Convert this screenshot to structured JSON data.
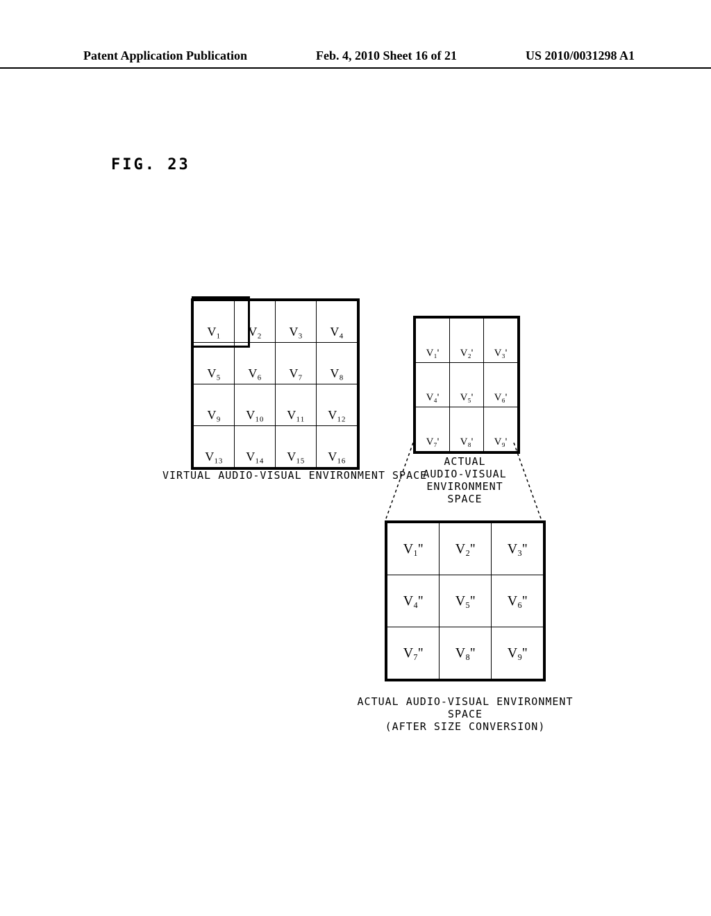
{
  "header": {
    "left": "Patent Application Publication",
    "center": "Feb. 4, 2010  Sheet 16 of 21",
    "right": "US 2010/0031298 A1"
  },
  "figure_label": "FIG. 23",
  "captions": {
    "virtual": "VIRTUAL AUDIO-VISUAL ENVIRONMENT SPACE",
    "actual_line1": "ACTUAL",
    "actual_line2": "AUDIO-VISUAL",
    "actual_line3": "ENVIRONMENT SPACE",
    "after_line1": "ACTUAL AUDIO-VISUAL ENVIRONMENT SPACE",
    "after_line2": "(AFTER SIZE CONVERSION)"
  },
  "grid4": {
    "r0": {
      "c0": "V₁",
      "c1": "V₂",
      "c2": "V₃",
      "c3": "V₄"
    },
    "r1": {
      "c0": "V₅",
      "c1": "V₆",
      "c2": "V₇",
      "c3": "V₈"
    },
    "r2": {
      "c0": "V₉",
      "c1": "V₁₀",
      "c2": "V₁₁",
      "c3": "V₁₂"
    },
    "r3": {
      "c0": "V₁₃",
      "c1": "V₁₄",
      "c2": "V₁₅",
      "c3": "V₁₆"
    }
  },
  "grid3s": {
    "r0": {
      "c0": "V₁'",
      "c1": "V₂'",
      "c2": "V₃'"
    },
    "r1": {
      "c0": "V₄'",
      "c1": "V₅'",
      "c2": "V₆'"
    },
    "r2": {
      "c0": "V₇'",
      "c1": "V₈'",
      "c2": "V₉'"
    }
  },
  "grid3l": {
    "r0": {
      "c0": "V₁''",
      "c1": "V₂''",
      "c2": "V₃''"
    },
    "r1": {
      "c0": "V₄''",
      "c1": "V₅''",
      "c2": "V₆''"
    },
    "r2": {
      "c0": "V₇''",
      "c1": "V₈''",
      "c2": "V₉''"
    }
  }
}
